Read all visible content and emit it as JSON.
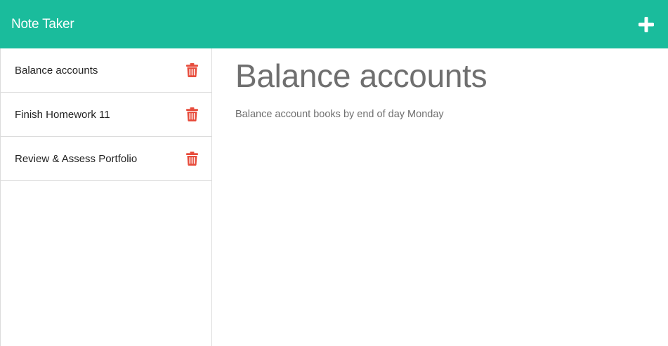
{
  "app": {
    "title": "Note Taker",
    "accent_color": "#1abc9c",
    "danger_color": "#e74c3c"
  },
  "header": {
    "add_icon": "plus-icon"
  },
  "notes": [
    {
      "title": "Balance accounts",
      "delete_icon": "trash-icon"
    },
    {
      "title": "Finish Homework 11",
      "delete_icon": "trash-icon"
    },
    {
      "title": "Review & Assess Portfolio",
      "delete_icon": "trash-icon"
    }
  ],
  "active_note": {
    "title": "Balance accounts",
    "text": "Balance account books by end of day Monday"
  }
}
